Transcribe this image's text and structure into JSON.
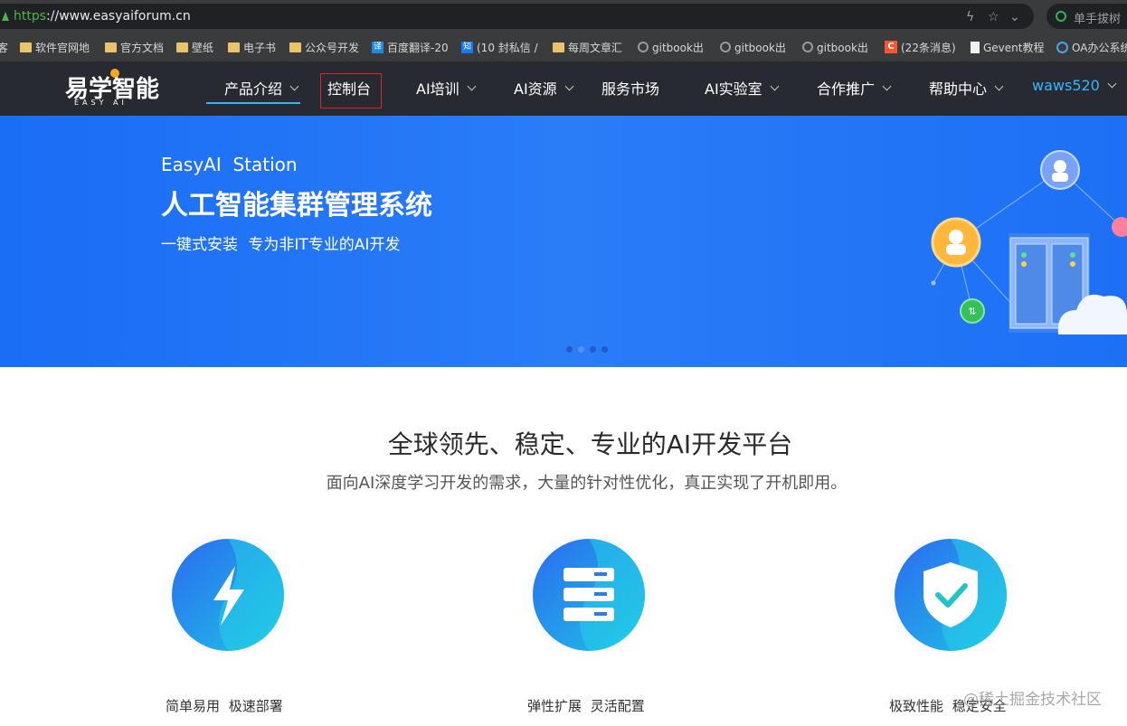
{
  "browser": {
    "url_scheme": "https",
    "url_rest": "://www.easyaiforum.cn",
    "extension_label": "单手拔树",
    "bookmarks": [
      {
        "label": "客",
        "icon": "none"
      },
      {
        "label": "软件官网地",
        "icon": "folder-icon"
      },
      {
        "label": "官方文档",
        "icon": "folder-icon"
      },
      {
        "label": "壁纸",
        "icon": "folder-icon"
      },
      {
        "label": "电子书",
        "icon": "folder-icon"
      },
      {
        "label": "公众号开发",
        "icon": "folder-icon"
      },
      {
        "label": "百度翻译-20",
        "icon": "translate-icon"
      },
      {
        "label": "(10 封私信 /",
        "icon": "zhihu-icon"
      },
      {
        "label": "每周文章汇",
        "icon": "folder-icon"
      },
      {
        "label": "gitbook出",
        "icon": "github-icon"
      },
      {
        "label": "gitbook出",
        "icon": "github-icon"
      },
      {
        "label": "gitbook出",
        "icon": "github-icon"
      },
      {
        "label": "(22条消息)",
        "icon": "csdn-icon"
      },
      {
        "label": "Gevent教程",
        "icon": "doc-icon"
      },
      {
        "label": "OA办公系统",
        "icon": "globe-icon"
      }
    ]
  },
  "nav": {
    "logo_cn": "易学智能",
    "logo_en": "EASY AI",
    "items": [
      {
        "label": "产品介绍",
        "dropdown": true
      },
      {
        "label": "控制台",
        "dropdown": false
      },
      {
        "label": "AI培训",
        "dropdown": true
      },
      {
        "label": "AI资源",
        "dropdown": true
      },
      {
        "label": "服务市场",
        "dropdown": false
      },
      {
        "label": "AI实验室",
        "dropdown": true
      },
      {
        "label": "合作推广",
        "dropdown": true
      },
      {
        "label": "帮助中心",
        "dropdown": true
      }
    ],
    "user": "waws520"
  },
  "banner": {
    "subtitle": "EasyAI  Station",
    "title": "人工智能集群管理系统",
    "desc": "一键式安装 专为非IT专业的AI开发",
    "slides": 4,
    "active_slide": 2
  },
  "main": {
    "headline": "全球领先、稳定、专业的AI开发平台",
    "subline": "面向AI深度学习开发的需求，大量的针对性优化，真正实现了开机即用。",
    "features": [
      {
        "label": "简单易用 极速部署",
        "icon": "lightning-icon"
      },
      {
        "label": "弹性扩展 灵活配置",
        "icon": "server-icon"
      },
      {
        "label": "极致性能 稳定安全",
        "icon": "shield-check-icon"
      }
    ]
  },
  "watermark": "@稀土掘金技术社区",
  "colors": {
    "nav_bg": "#272a31",
    "accent": "#33b8ff",
    "banner_blue": "#1a6df5",
    "highlight_red": "#d12a2a"
  }
}
